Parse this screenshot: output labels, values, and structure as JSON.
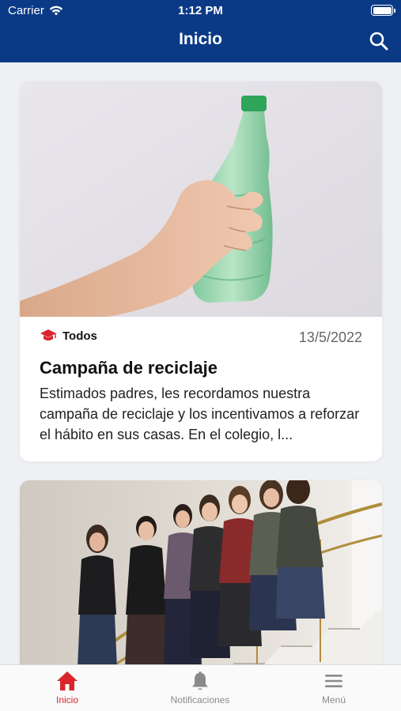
{
  "status_bar": {
    "carrier": "Carrier",
    "time": "1:12 PM"
  },
  "header": {
    "title": "Inicio"
  },
  "posts": [
    {
      "category": "Todos",
      "date": "13/5/2022",
      "title": "Campaña de reciclaje",
      "excerpt": "Estimados padres, les recordamos nuestra campaña de reciclaje y los incentivamos a reforzar el hábito en sus casas. En el colegio, l..."
    }
  ],
  "tabs": [
    {
      "label": "Inicio",
      "icon": "home-icon",
      "active": true
    },
    {
      "label": "Notificaciones",
      "icon": "bell-icon",
      "active": false
    },
    {
      "label": "Menú",
      "icon": "hamburger-menu-icon",
      "active": false
    }
  ],
  "colors": {
    "header_bg": "#0a3a86",
    "accent_red": "#d8262c",
    "page_bg": "#eef0f4"
  }
}
